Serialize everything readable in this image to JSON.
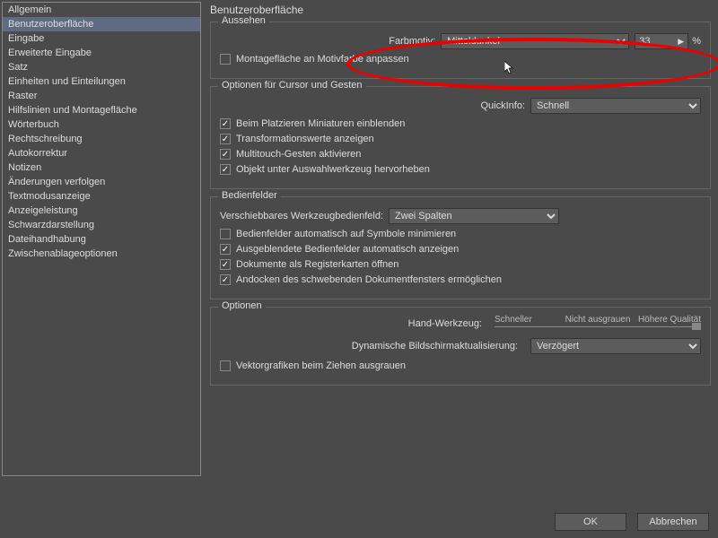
{
  "sidebar": {
    "items": [
      "Allgemein",
      "Benutzeroberfläche",
      "Eingabe",
      "Erweiterte Eingabe",
      "Satz",
      "Einheiten und Einteilungen",
      "Raster",
      "Hilfslinien und Montagefläche",
      "Wörterbuch",
      "Rechtschreibung",
      "Autokorrektur",
      "Notizen",
      "Änderungen verfolgen",
      "Textmodusanzeige",
      "Anzeigeleistung",
      "Schwarzdarstellung",
      "Dateihandhabung",
      "Zwischenablageoptionen"
    ],
    "activeIndex": 1
  },
  "page": {
    "title": "Benutzeroberfläche"
  },
  "appearance": {
    "group_title": "Aussehen",
    "theme_label": "Farbmotiv:",
    "theme_value": "Mitteldunkel",
    "value_num": "33",
    "percent": "%",
    "checkbox_paste": {
      "label": "Montagefläche an Motivfarbe anpassen",
      "checked": false
    }
  },
  "cursor_group": {
    "group_title": "Optionen für Cursor und Gesten",
    "quickinfo_label": "QuickInfo:",
    "quickinfo_value": "Schnell",
    "cb1": {
      "label": "Beim Platzieren Miniaturen einblenden",
      "checked": true
    },
    "cb2": {
      "label": "Transformationswerte anzeigen",
      "checked": true
    },
    "cb3": {
      "label": "Multitouch-Gesten aktivieren",
      "checked": true
    },
    "cb4": {
      "label": "Objekt unter Auswahlwerkzeug hervorheben",
      "checked": true
    }
  },
  "panels": {
    "group_title": "Bedienfelder",
    "toolbar_label": "Verschiebbares Werkzeugbedienfeld:",
    "toolbar_value": "Zwei Spalten",
    "cb1": {
      "label": "Bedienfelder automatisch auf Symbole minimieren",
      "checked": false
    },
    "cb2": {
      "label": "Ausgeblendete Bedienfelder automatisch anzeigen",
      "checked": true
    },
    "cb3": {
      "label": "Dokumente als Registerkarten öffnen",
      "checked": true
    },
    "cb4": {
      "label": "Andocken des schwebenden Dokumentfensters ermöglichen",
      "checked": true
    }
  },
  "options": {
    "group_title": "Optionen",
    "faster": "Schneller",
    "quality": "Höhere Qualität",
    "no_gray": "Nicht ausgrauen",
    "hand_label": "Hand-Werkzeug:",
    "dyn_label": "Dynamische Bildschirmaktualisierung:",
    "dyn_value": "Verzögert",
    "cb_vector": {
      "label": "Vektorgrafiken beim Ziehen ausgrauen",
      "checked": false
    }
  },
  "footer": {
    "ok": "OK",
    "cancel": "Abbrechen"
  }
}
